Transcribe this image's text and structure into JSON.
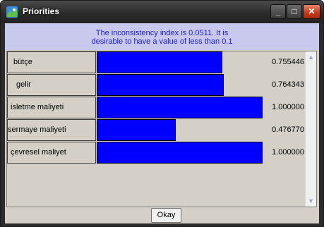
{
  "window": {
    "title": "Priorities",
    "controls": {
      "minimize": "_",
      "maximize": "□",
      "close": "✕"
    }
  },
  "message": {
    "line1": "The inconsistency index is 0.0511.  It is",
    "line2": "desirable to have a value of less than 0.1"
  },
  "priorities": [
    {
      "label": "bütçe",
      "indent": 2,
      "value": "0.755446",
      "fraction": 0.755446
    },
    {
      "label": "gelir",
      "indent": 3,
      "value": "0.764343",
      "fraction": 0.764343
    },
    {
      "label": "isletme maliyeti",
      "indent": 1,
      "value": "1.000000",
      "fraction": 1.0
    },
    {
      "label": "sermaye maliyeti",
      "indent": 0,
      "value": "0.476770",
      "fraction": 0.47677
    },
    {
      "label": "çevresel maliyet",
      "indent": 1,
      "value": "1.000000",
      "fraction": 1.0
    }
  ],
  "scrollbar": {
    "up": "▲",
    "down": "▼"
  },
  "okay_button": "Okay",
  "colors": {
    "bar": "#0000ff",
    "message_bg": "#c9c9ee",
    "message_text": "#1a1acc"
  }
}
